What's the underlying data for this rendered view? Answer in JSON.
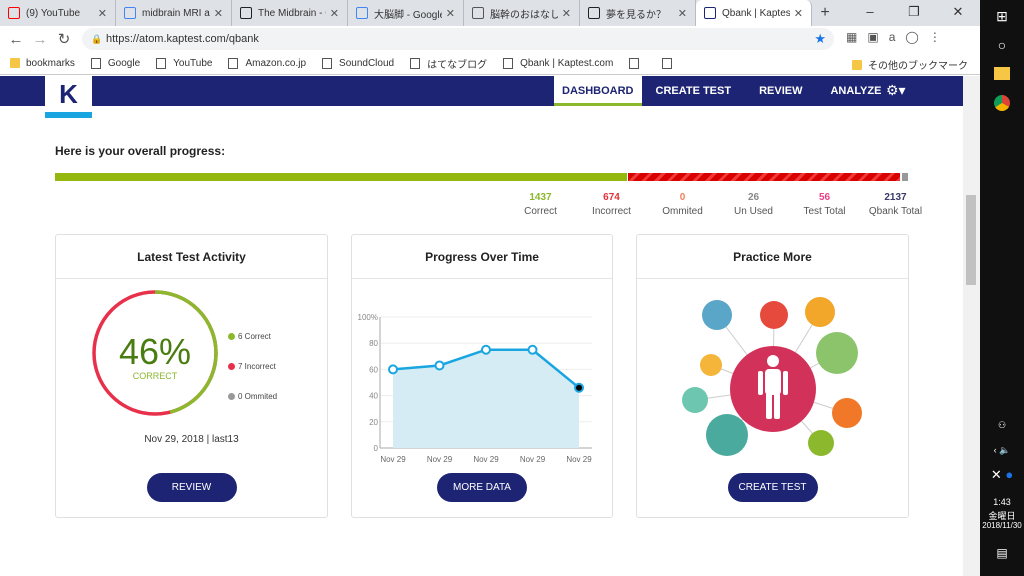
{
  "browser": {
    "tabs": [
      {
        "title": "(9) YouTube",
        "icon": "youtube-icon",
        "color": "#ff0000"
      },
      {
        "title": "midbrain MRI an",
        "icon": "google-icon",
        "color": "#4285f4"
      },
      {
        "title": "The Midbrain - C",
        "icon": "page-icon",
        "color": "#222"
      },
      {
        "title": "大脳脚 - Google",
        "icon": "google-icon",
        "color": "#4285f4"
      },
      {
        "title": "脳幹のおはなし | ",
        "icon": "page-icon",
        "color": "#555"
      },
      {
        "title": "夢を見るか？",
        "icon": "page-icon",
        "color": "#222"
      },
      {
        "title": "Qbank | Kaptest.",
        "icon": "kaptest-icon",
        "color": "#1d2473",
        "active": true
      }
    ],
    "url": "https://atom.kaptest.com/qbank",
    "bookmarks": [
      "bookmarks",
      "Google",
      "YouTube",
      "Amazon.co.jp",
      "SoundCloud",
      "はてなブログ",
      "Qbank | Kaptest.com"
    ],
    "other_bookmarks": "その他のブックマーク"
  },
  "nav": {
    "logo": "K",
    "items": [
      "DASHBOARD",
      "CREATE TEST",
      "REVIEW",
      "ANALYZE"
    ],
    "active": "DASHBOARD"
  },
  "progress": {
    "heading": "Here is your overall progress:",
    "correct": 1437,
    "incorrect": 674,
    "ommited": 0,
    "unused": 26,
    "qbank_total": 2137,
    "stats": [
      {
        "value": "1437",
        "label": "Correct",
        "color": "#8cb82e"
      },
      {
        "value": "674",
        "label": "Incorrect",
        "color": "#e0303a"
      },
      {
        "value": "0",
        "label": "Ommited",
        "color": "#f08060"
      },
      {
        "value": "26",
        "label": "Un Used",
        "color": "#888888"
      },
      {
        "value": "56",
        "label": "Test Total",
        "color": "#e8408a"
      },
      {
        "value": "2137",
        "label": "Qbank Total",
        "color": "#3a3a6a"
      }
    ]
  },
  "latest": {
    "title": "Latest Test Activity",
    "percent": "46%",
    "percent_value": 46,
    "sub": "CORRECT",
    "legend": [
      "6 Correct",
      "7 Incorrect",
      "0 Ommited"
    ],
    "date": "Nov 29, 2018 | last13",
    "button": "REVIEW"
  },
  "progress_time": {
    "title": "Progress Over Time",
    "button": "MORE DATA"
  },
  "practice": {
    "title": "Practice More",
    "button": "CREATE TEST"
  },
  "chart_data": {
    "type": "area",
    "x": [
      "Nov 29",
      "Nov 29",
      "Nov 29",
      "Nov 29",
      "Nov 29"
    ],
    "values": [
      60,
      63,
      75,
      75,
      46
    ],
    "yticks": [
      "0",
      "20",
      "40",
      "60",
      "80",
      "100%"
    ],
    "ylim": [
      0,
      100
    ],
    "grid": true,
    "color": "#19a6e0"
  },
  "taskbar": {
    "time": "1:43",
    "day": "金曜日",
    "date": "2018/11/30"
  }
}
